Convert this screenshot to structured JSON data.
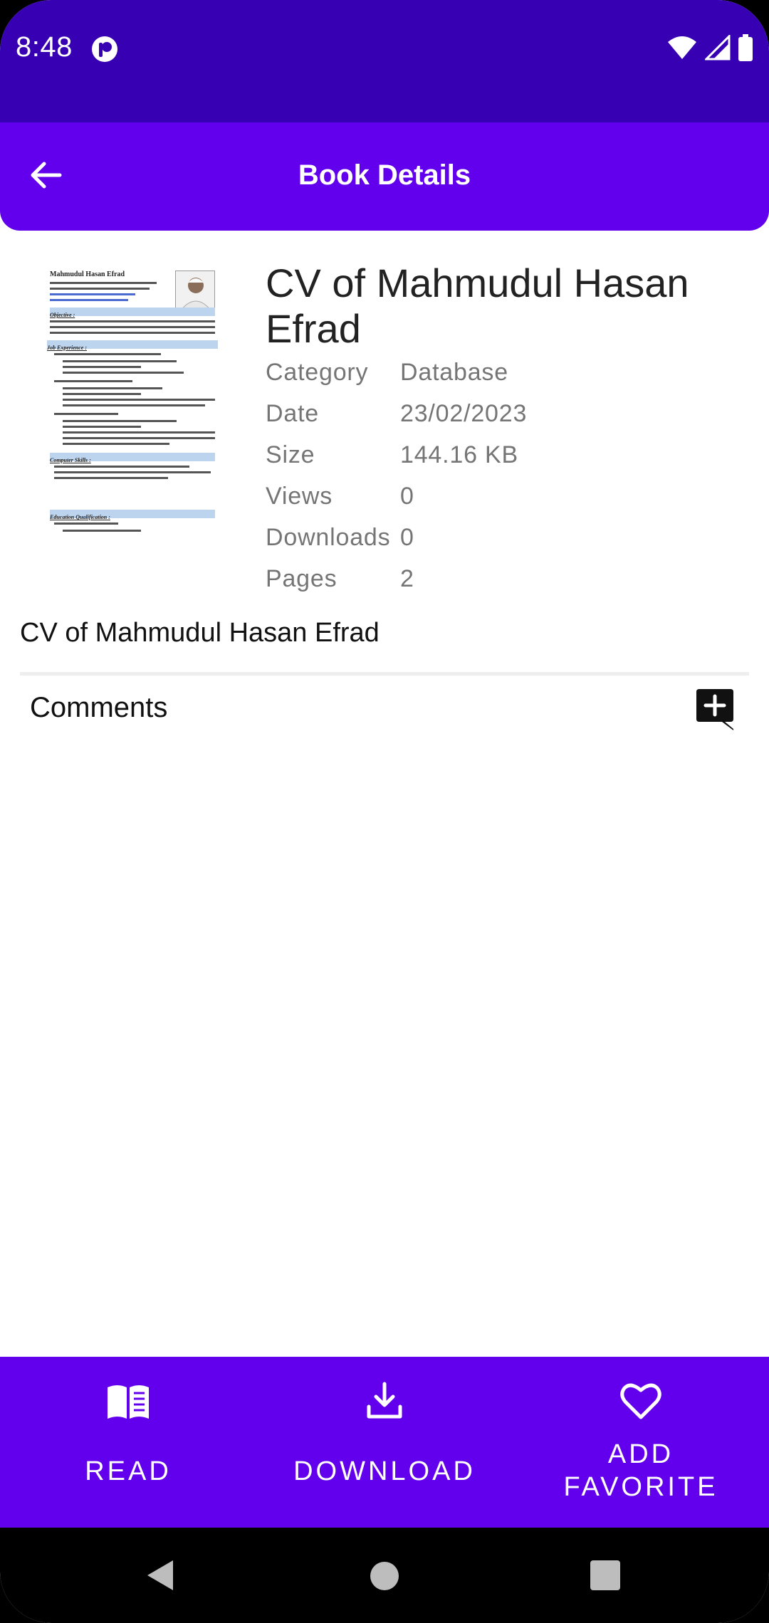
{
  "status_bar": {
    "time": "8:48",
    "icons": [
      "app-notification-icon",
      "wifi-icon",
      "signal-icon",
      "battery-icon"
    ]
  },
  "app_bar": {
    "title": "Book Details",
    "back_icon": "arrow-back-icon"
  },
  "book": {
    "title": "CV of Mahmudul Hasan Efrad",
    "description": "CV of Mahmudul Hasan Efrad",
    "meta": [
      {
        "key": "Category",
        "value": "Database"
      },
      {
        "key": "Date",
        "value": "23/02/2023"
      },
      {
        "key": "Size",
        "value": "144.16 KB"
      },
      {
        "key": "Views",
        "value": "0"
      },
      {
        "key": "Downloads",
        "value": "0"
      },
      {
        "key": "Pages",
        "value": "2"
      }
    ],
    "thumbnail": {
      "name": "Mahmudul Hasan Efrad",
      "sections": [
        "Objective :",
        "Job Experience :",
        "Computer Skills :",
        "Education Qualification :"
      ]
    }
  },
  "comments": {
    "label": "Comments",
    "add_icon": "add-comment-icon"
  },
  "actions": [
    {
      "label": "READ",
      "icon": "book-open-icon"
    },
    {
      "label": "DOWNLOAD",
      "icon": "download-icon"
    },
    {
      "label": "ADD FAVORITE",
      "icon": "heart-outline-icon"
    }
  ],
  "colors": {
    "status_bar": "#3700b3",
    "primary": "#6200ee",
    "meta_text": "#757575"
  }
}
